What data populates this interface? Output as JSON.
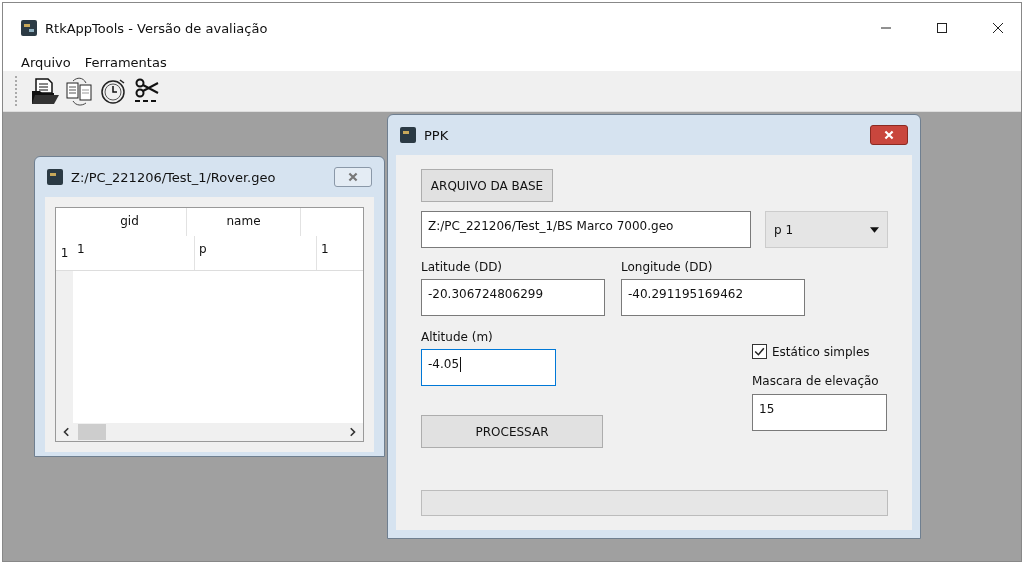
{
  "window": {
    "title": "RtkAppTools - Versão de avaliação"
  },
  "menu": [
    "Arquivo",
    "Ferramentas"
  ],
  "toolbar": [
    {
      "kind": "open"
    },
    {
      "kind": "convert"
    },
    {
      "kind": "timer"
    },
    {
      "kind": "cut"
    }
  ],
  "table_window": {
    "title": "Z:/PC_221206/Test_1/Rover.geo",
    "columns": [
      {
        "header": "gid"
      },
      {
        "header": "name"
      },
      {}
    ],
    "rows": [
      {
        "number": "1",
        "cells": [
          "1",
          "p",
          "1"
        ]
      }
    ]
  },
  "ppk_window": {
    "title": "PPK",
    "base_button": "ARQUIVO DA BASE",
    "base_file": "Z:/PC_221206/Test_1/BS Marco 7000.geo",
    "point_select": "p 1",
    "latitude": {
      "label": "Latitude (DD)",
      "value": "-20.306724806299",
      "focused": false
    },
    "longitude": {
      "label": "Longitude (DD)",
      "value": "-40.291195169462",
      "focused": false
    },
    "altitude": {
      "label": "Altitude (m)",
      "value": "-4.05",
      "focused": true
    },
    "static": {
      "label": "Estático simples",
      "checked": true
    },
    "elevation_mask": {
      "label": "Mascara de elevação",
      "value": "15",
      "focused": false
    },
    "process_button": "PROCESSAR",
    "progress": {
      "level": 0
    }
  }
}
